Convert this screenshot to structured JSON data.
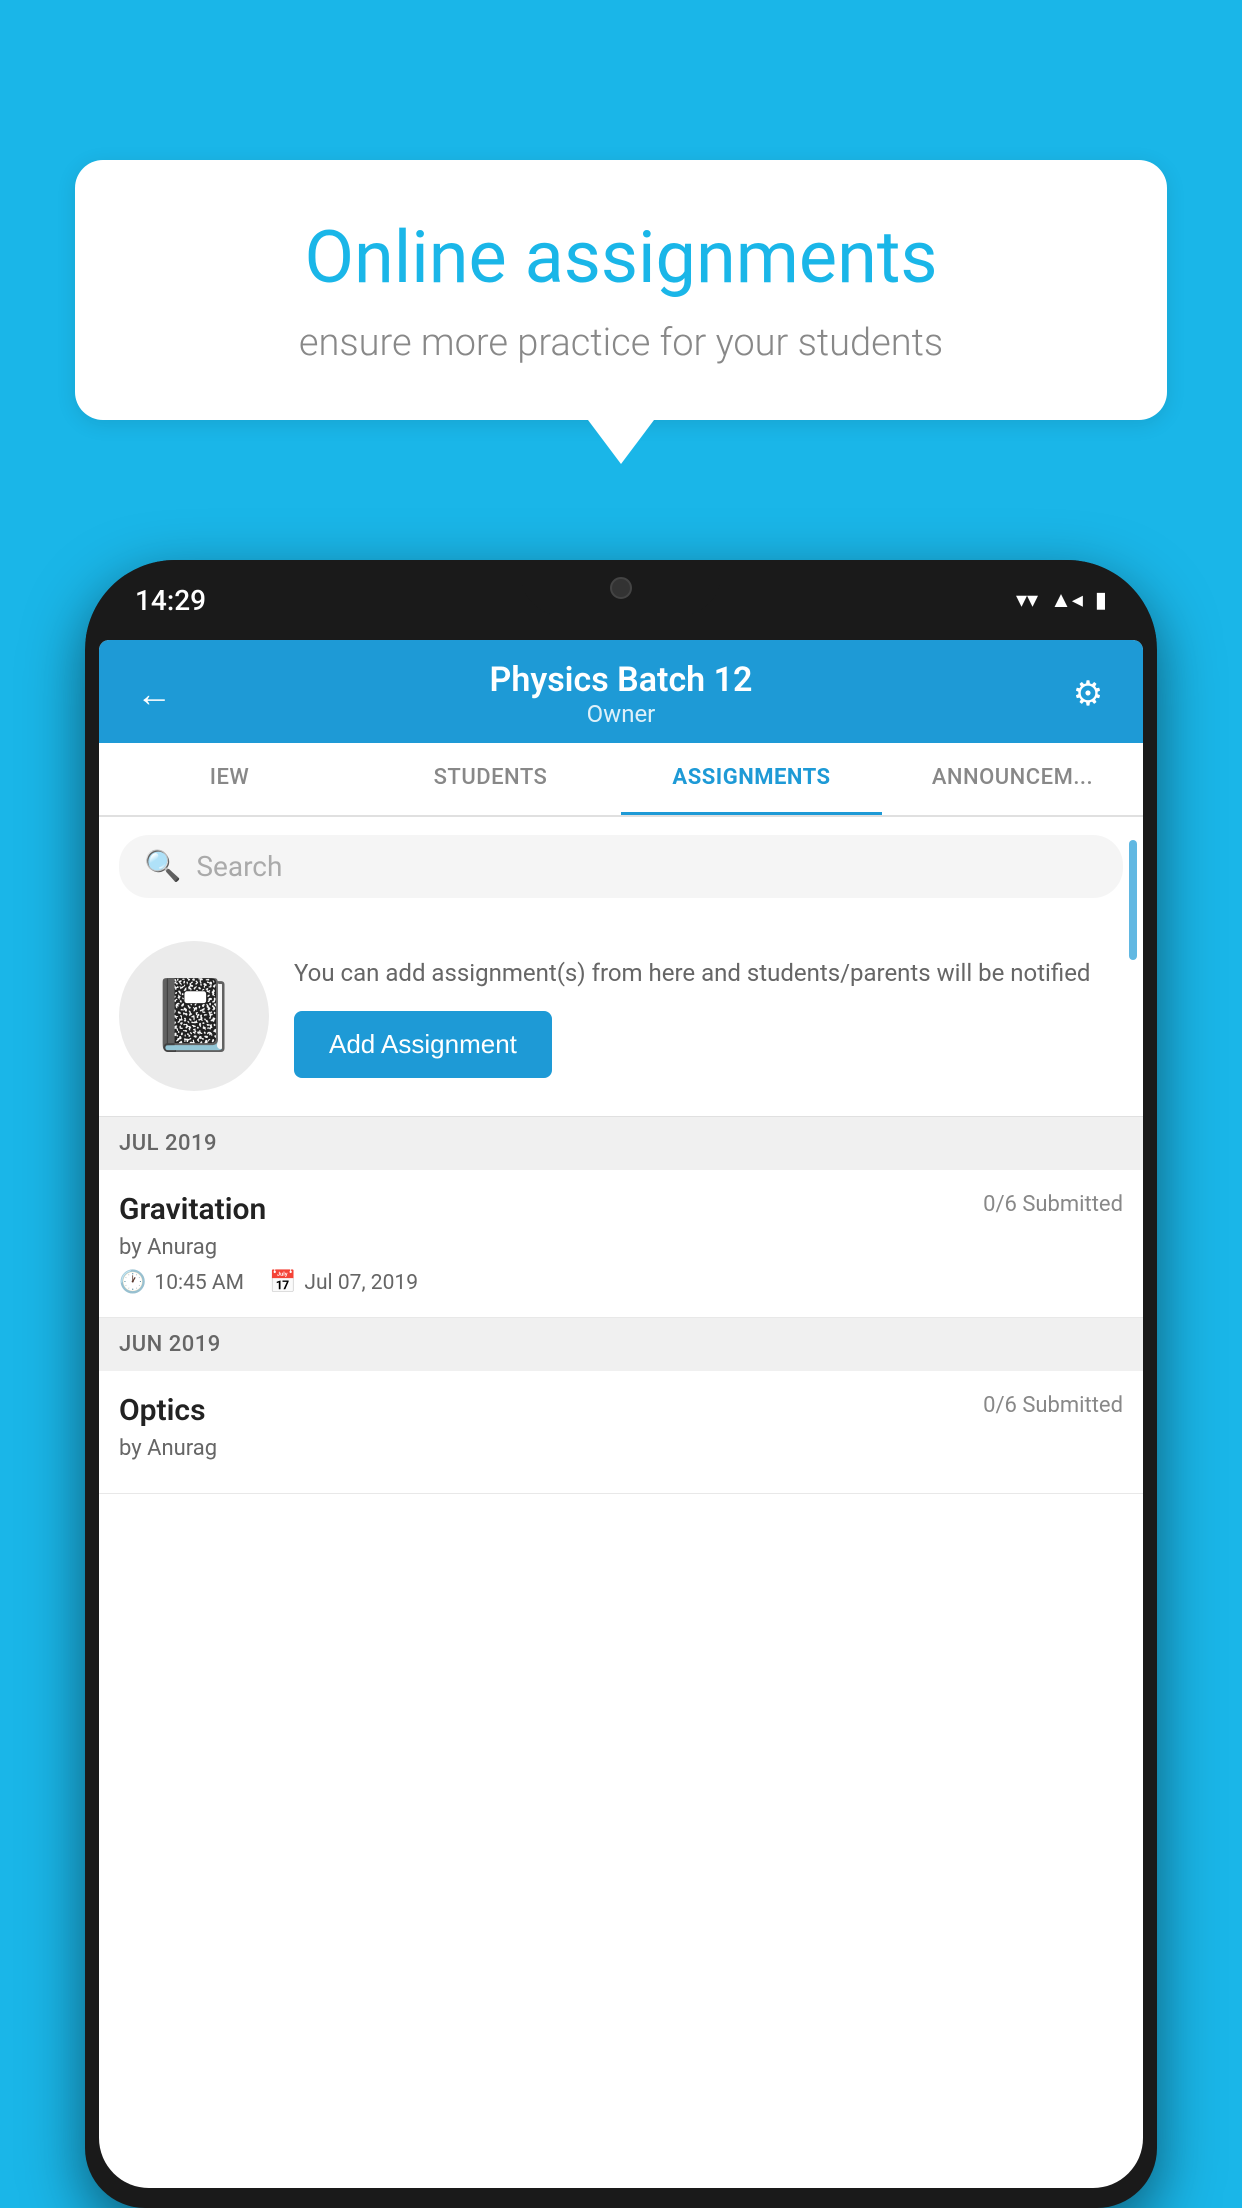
{
  "background": {
    "color": "#1ab6e8"
  },
  "speech_bubble": {
    "title": "Online assignments",
    "subtitle": "ensure more practice for your students"
  },
  "phone": {
    "time": "14:29",
    "status_bar": {
      "wifi": "▾",
      "signal": "▲",
      "battery": "▮"
    }
  },
  "app": {
    "header": {
      "title": "Physics Batch 12",
      "subtitle": "Owner",
      "back_label": "←",
      "settings_label": "⚙"
    },
    "tabs": [
      {
        "label": "IEW",
        "active": false
      },
      {
        "label": "STUDENTS",
        "active": false
      },
      {
        "label": "ASSIGNMENTS",
        "active": true
      },
      {
        "label": "ANNOUNCEM...",
        "active": false
      }
    ],
    "search": {
      "placeholder": "Search"
    },
    "add_assignment": {
      "description": "You can add assignment(s) from here and students/parents will be notified",
      "button_label": "Add Assignment"
    },
    "sections": [
      {
        "month": "JUL 2019",
        "assignments": [
          {
            "title": "Gravitation",
            "submitted": "0/6 Submitted",
            "author": "by Anurag",
            "time": "10:45 AM",
            "date": "Jul 07, 2019"
          }
        ]
      },
      {
        "month": "JUN 2019",
        "assignments": [
          {
            "title": "Optics",
            "submitted": "0/6 Submitted",
            "author": "by Anurag",
            "time": "",
            "date": ""
          }
        ]
      }
    ]
  }
}
